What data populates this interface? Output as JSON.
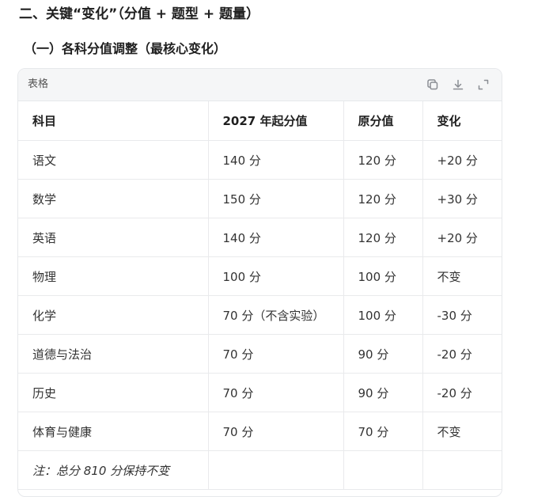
{
  "heading2": "二、关键“变化”（分值 + 题型 + 题量）",
  "heading3": "（一）各科分值调整（最核心变化）",
  "table_card": {
    "title": "表格",
    "tools": [
      "copy-icon",
      "download-icon",
      "expand-icon"
    ],
    "columns": [
      "科目",
      "2027 年起分值",
      "原分值",
      "变化"
    ],
    "rows": [
      [
        "语文",
        "140 分",
        "120 分",
        "+20 分"
      ],
      [
        "数学",
        "150 分",
        "120 分",
        "+30 分"
      ],
      [
        "英语",
        "140 分",
        "120 分",
        "+20 分"
      ],
      [
        "物理",
        "100 分",
        "100 分",
        "不变"
      ],
      [
        "化学",
        "70 分（不含实验）",
        "100 分",
        "-30 分"
      ],
      [
        "道德与法治",
        "70 分",
        "90 分",
        "-20 分"
      ],
      [
        "历史",
        "70 分",
        "90 分",
        "-20 分"
      ],
      [
        "体育与健康",
        "70 分",
        "70 分",
        "不变"
      ],
      [
        "注：总分 810 分保持不变",
        "",
        "",
        ""
      ]
    ]
  }
}
